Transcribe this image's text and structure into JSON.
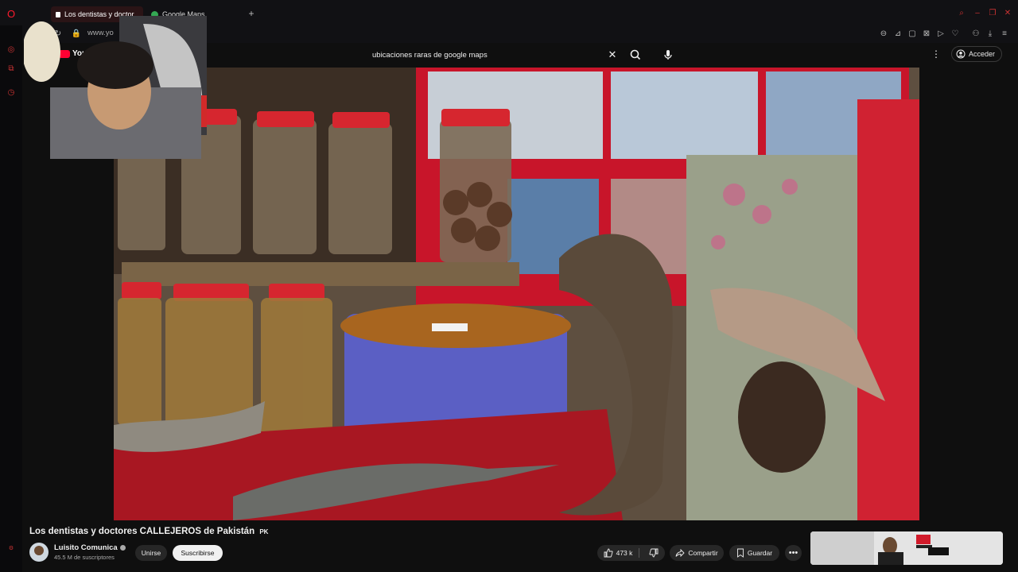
{
  "browser": {
    "tabs": [
      {
        "label": "Los dentistas y doctor",
        "active": true
      },
      {
        "label": "Google Maps",
        "active": false
      }
    ],
    "new_tab": "+",
    "url": "www.yo"
  },
  "youtube": {
    "logo": "YouTube",
    "search_value": "ubicaciones raras de google maps",
    "signin_label": "Acceder"
  },
  "video": {
    "title": "Los dentistas y doctores CALLEJEROS de Pakistán",
    "flag_tag": "PK",
    "channel_name": "Luisito Comunica",
    "subscribers": "45.5 M de suscriptores",
    "join_label": "Unirse",
    "subscribe_label": "Suscribirse",
    "likes": "473 k",
    "share_label": "Compartir",
    "save_label": "Guardar"
  },
  "colors": {
    "accent_red": "#ff0033",
    "background": "#0f0f0f",
    "pill_dark": "#272727"
  },
  "icons": [
    "opera-logo",
    "sound-icon",
    "maps-icon",
    "refresh-icon",
    "lock-icon",
    "search-icon",
    "microphone-icon",
    "close-icon",
    "kebab-menu-icon",
    "account-icon",
    "like-icon",
    "dislike-icon",
    "share-icon",
    "save-icon",
    "more-icon",
    "verified-icon"
  ]
}
